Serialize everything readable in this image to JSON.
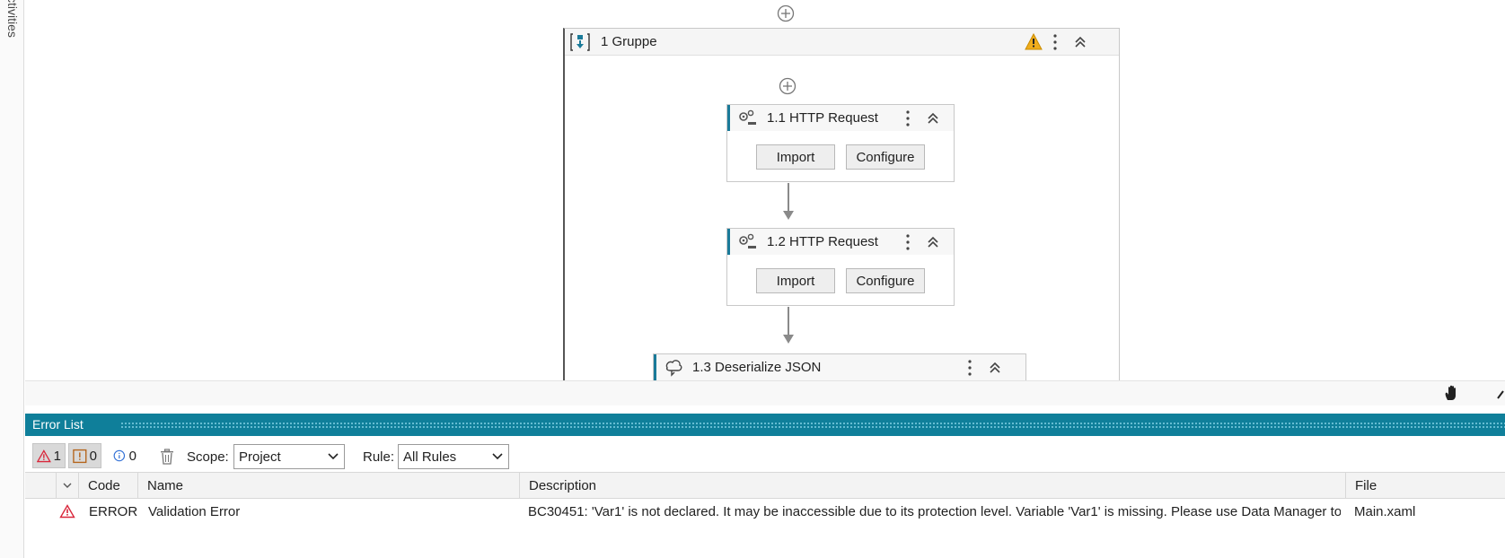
{
  "sidebar": {
    "activities_label": "ctivities"
  },
  "group": {
    "title": "1 Gruppe"
  },
  "activities": [
    {
      "title": "1.1 HTTP Request",
      "buttons": [
        "Import",
        "Configure"
      ]
    },
    {
      "title": "1.2 HTTP Request",
      "buttons": [
        "Import",
        "Configure"
      ]
    },
    {
      "title": "1.3 Deserialize JSON"
    }
  ],
  "error_panel": {
    "title": "Error List",
    "counts": {
      "errors": "1",
      "warnings": "0",
      "infos": "0"
    },
    "scope_label": "Scope:",
    "scope_value": "Project",
    "rule_label": "Rule:",
    "rule_value": "All Rules",
    "columns": [
      "Code",
      "Name",
      "Description",
      "File"
    ],
    "rows": [
      {
        "code": "ERROR",
        "name": "Validation Error",
        "description": "BC30451: 'Var1' is not declared. It may be inaccessible due to its protection level. Variable 'Var1' is missing. Please use Data Manager to...",
        "file": "Main.xaml"
      }
    ]
  },
  "colors": {
    "accent": "#0f7f9a",
    "error": "#d9263a",
    "warning": "#f0ad1d",
    "info": "#2f6fd6"
  }
}
